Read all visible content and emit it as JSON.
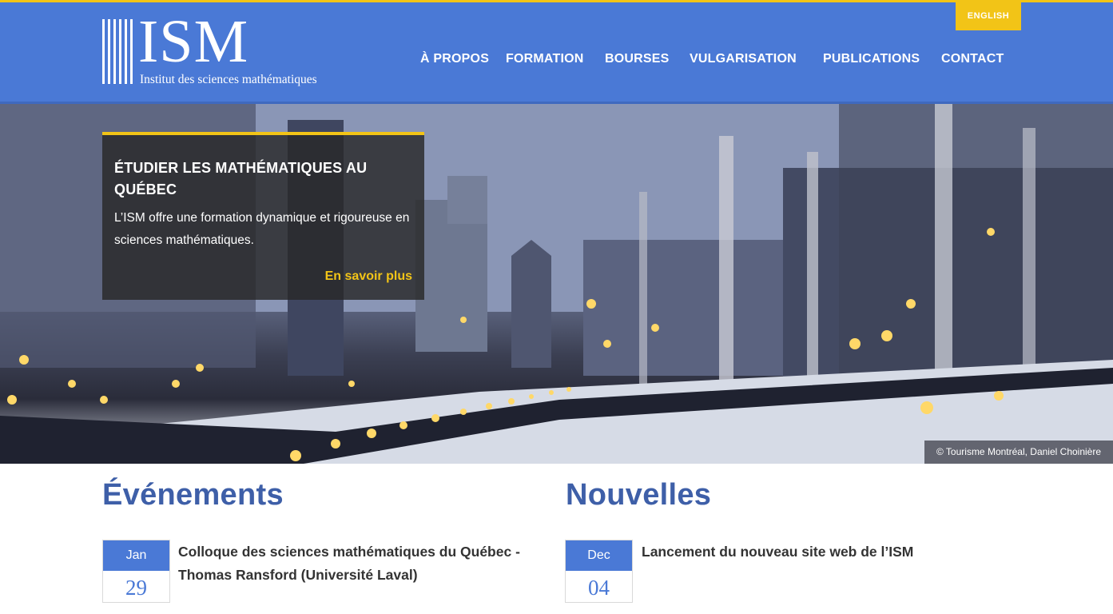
{
  "header": {
    "logo_text": "ISM",
    "logo_subtitle": "Institut des sciences mathématiques",
    "language_button": "ENGLISH",
    "nav": [
      {
        "label": "À PROPOS"
      },
      {
        "label": "FORMATION"
      },
      {
        "label": "BOURSES"
      },
      {
        "label": "VULGARISATION"
      },
      {
        "label": "PUBLICATIONS"
      },
      {
        "label": "CONTACT"
      }
    ]
  },
  "hero": {
    "title": "ÉTUDIER LES MATHÉMATIQUES AU QUÉBEC",
    "text": "L’ISM offre une formation dynamique et rigoureuse en sciences mathématiques.",
    "link": "En savoir plus",
    "credit": "© Tourisme Montréal, Daniel Choinière"
  },
  "events": {
    "heading": "Événements",
    "items": [
      {
        "month": "Jan",
        "day": "29",
        "title": "Colloque des sciences mathématiques du Québec - Thomas Ransford (Université Laval)"
      }
    ]
  },
  "news": {
    "heading": "Nouvelles",
    "items": [
      {
        "month": "Dec",
        "day": "04",
        "title": "Lancement du nouveau site web de l’ISM"
      }
    ]
  },
  "colors": {
    "brand_blue": "#4a79d6",
    "accent_yellow": "#f2c417",
    "heading_blue": "#3e5fa8"
  }
}
